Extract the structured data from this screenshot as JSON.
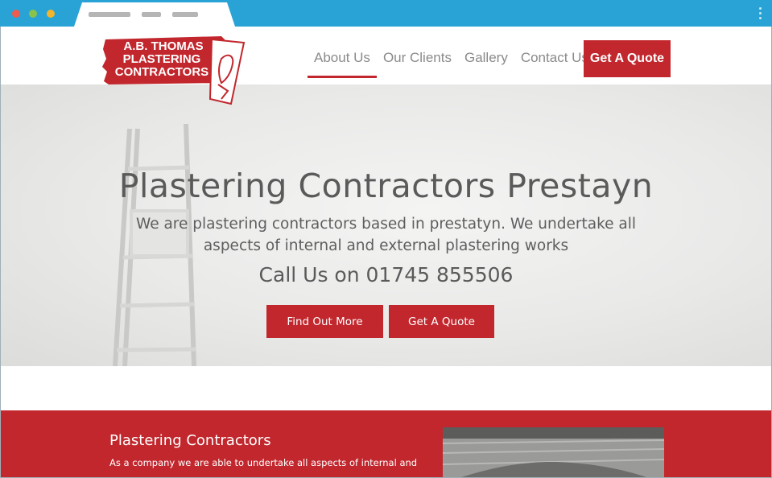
{
  "browser": {
    "colors": {
      "bar": "#29a3d6",
      "close": "#ed5c4f",
      "minimize": "#8bc34a",
      "maximize": "#f5b52a"
    }
  },
  "logo": {
    "line1": "A.B. THOMAS",
    "line2": "PLASTERING",
    "line3": "CONTRACTORS",
    "icon": "plastering-trowel-icon"
  },
  "nav": {
    "items": [
      {
        "label": "About Us",
        "active": true
      },
      {
        "label": "Our Clients",
        "active": false
      },
      {
        "label": "Gallery",
        "active": false
      },
      {
        "label": "Contact Us",
        "active": false
      }
    ],
    "cta": "Get A Quote"
  },
  "hero": {
    "title": "Plastering Contractors Prestayn",
    "lead_line1": "We are plastering contractors based in prestatyn. We undertake all",
    "lead_line2": "aspects of internal and external plastering works",
    "call": "Call Us on 01745 855506",
    "find_btn": "Find Out More",
    "quote_btn": "Get A Quote"
  },
  "section": {
    "heading": "Plastering Contractors",
    "text": "As a company we are able to undertake all aspects of internal and"
  },
  "colors": {
    "accent": "#c1272d",
    "text": "#5a5a5a"
  }
}
